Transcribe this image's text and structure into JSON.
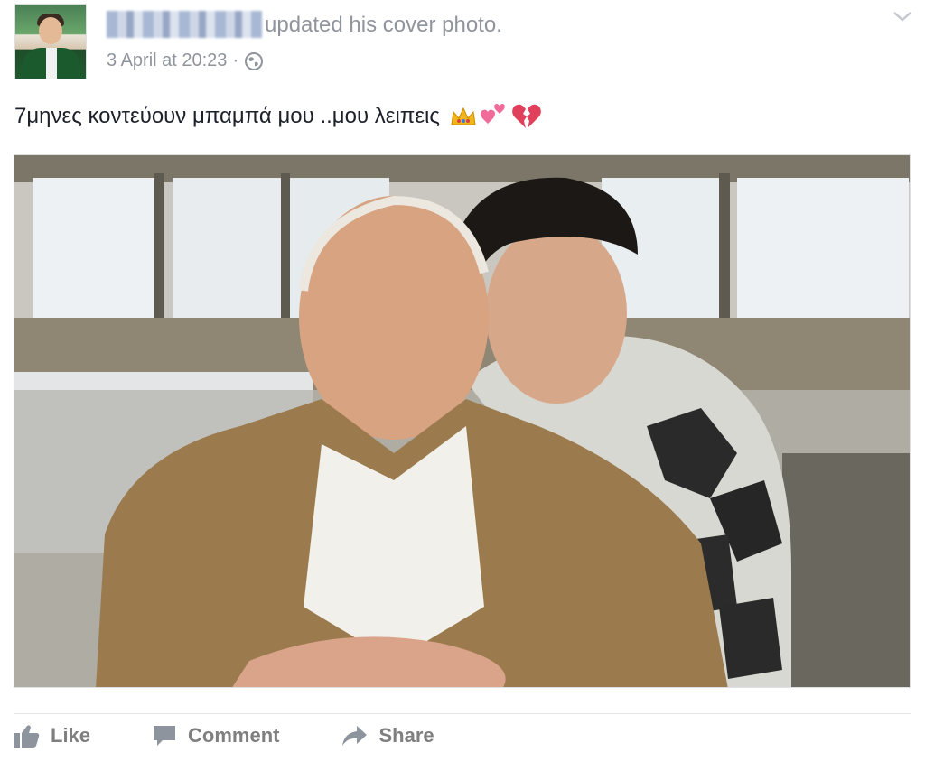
{
  "post": {
    "headline": "updated his cover photo.",
    "timestamp": "3 April at 20:23",
    "separator": "·",
    "audience_icon": "globe-icon",
    "text": "7μηνες κοντεύουν μπαμπά μου ..μου λειπεις",
    "emojis": [
      "crown",
      "two-hearts",
      "broken-heart"
    ],
    "menu_icon": "chevron-down-icon"
  },
  "actions": {
    "like_label": "Like",
    "comment_label": "Comment",
    "share_label": "Share"
  },
  "colors": {
    "meta_gray": "#90949c",
    "action_gray": "#7f7f7f",
    "text": "#1d2129"
  }
}
